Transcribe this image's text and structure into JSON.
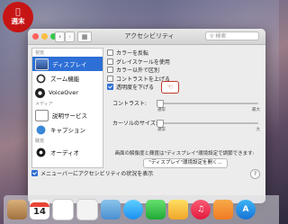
{
  "badge": {
    "text": "週末"
  },
  "window": {
    "title": "アクセシビリティ",
    "search_placeholder": "検索"
  },
  "sidebar": {
    "sections": [
      {
        "label": "視覚"
      },
      {
        "label": "メディア"
      },
      {
        "label": "聴覚"
      }
    ],
    "items": [
      {
        "label": "ディスプレイ",
        "icon": "display-icon"
      },
      {
        "label": "ズーム機能",
        "icon": "zoom-icon"
      },
      {
        "label": "VoiceOver",
        "icon": "voiceover-icon"
      },
      {
        "label": "説明サービス",
        "icon": "descriptions-icon"
      },
      {
        "label": "キャプション",
        "icon": "captions-icon"
      },
      {
        "label": "オーディオ",
        "icon": "audio-icon"
      }
    ]
  },
  "options": [
    {
      "label": "カラーを反転",
      "checked": false
    },
    {
      "label": "グレイスケールを使用",
      "checked": false
    },
    {
      "label": "カラー以外で区別",
      "checked": false
    },
    {
      "label": "コントラストを上げる",
      "checked": false
    },
    {
      "label": "透明度を下げる",
      "checked": true
    }
  ],
  "sliders": {
    "contrast": {
      "label": "コントラスト:",
      "min_label": "通常",
      "max_label": "最大"
    },
    "cursor": {
      "label": "カーソルのサイズ:",
      "min_label": "通常",
      "max_label": "大"
    }
  },
  "note": "画面の解像度と輝度は\"ディスプレイ\"環境設定で調節できます:",
  "open_display_button": "\"ディスプレイ\"環境設定を開く...",
  "menu_bar_checkbox": {
    "label": "メニューバーにアクセシビリティの状況を表示",
    "checked": true
  },
  "help_label": "?",
  "dock": {
    "calendar_day": "14"
  }
}
